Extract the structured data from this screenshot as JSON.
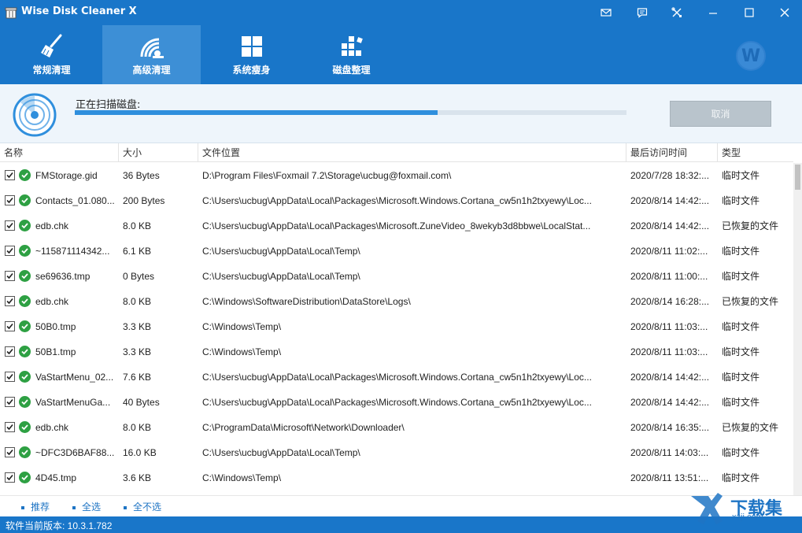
{
  "app": {
    "title": "Wise Disk Cleaner X"
  },
  "nav": {
    "tabs": [
      {
        "label": "常规清理",
        "icon": "broom-icon"
      },
      {
        "label": "高级清理",
        "icon": "satellite-dish-icon"
      },
      {
        "label": "系统瘦身",
        "icon": "windows-logo-icon"
      },
      {
        "label": "磁盘整理",
        "icon": "defrag-blocks-icon"
      }
    ],
    "active_index": 1,
    "avatar_letter": "W"
  },
  "scan": {
    "status_label": "正在扫描磁盘:",
    "progress": 0.658,
    "cancel_label": "取消"
  },
  "table": {
    "headers": [
      "名称",
      "大小",
      "文件位置",
      "最后访问时间",
      "类型"
    ],
    "rows": [
      {
        "name": "FMStorage.gid",
        "size": "36 Bytes",
        "path": "D:\\Program Files\\Foxmail 7.2\\Storage\\ucbug@foxmail.com\\",
        "time": "2020/7/28 18:32:...",
        "type": "临时文件"
      },
      {
        "name": "Contacts_01.080...",
        "size": "200 Bytes",
        "path": "C:\\Users\\ucbug\\AppData\\Local\\Packages\\Microsoft.Windows.Cortana_cw5n1h2txyewy\\Loc...",
        "time": "2020/8/14 14:42:...",
        "type": "临时文件"
      },
      {
        "name": "edb.chk",
        "size": "8.0 KB",
        "path": "C:\\Users\\ucbug\\AppData\\Local\\Packages\\Microsoft.ZuneVideo_8wekyb3d8bbwe\\LocalStat...",
        "time": "2020/8/14 14:42:...",
        "type": "已恢复的文件"
      },
      {
        "name": "~115871114342...",
        "size": "6.1 KB",
        "path": "C:\\Users\\ucbug\\AppData\\Local\\Temp\\",
        "time": "2020/8/11 11:02:...",
        "type": "临时文件"
      },
      {
        "name": "se69636.tmp",
        "size": "0 Bytes",
        "path": "C:\\Users\\ucbug\\AppData\\Local\\Temp\\",
        "time": "2020/8/11 11:00:...",
        "type": "临时文件"
      },
      {
        "name": "edb.chk",
        "size": "8.0 KB",
        "path": "C:\\Windows\\SoftwareDistribution\\DataStore\\Logs\\",
        "time": "2020/8/14 16:28:...",
        "type": "已恢复的文件"
      },
      {
        "name": "50B0.tmp",
        "size": "3.3 KB",
        "path": "C:\\Windows\\Temp\\",
        "time": "2020/8/11 11:03:...",
        "type": "临时文件"
      },
      {
        "name": "50B1.tmp",
        "size": "3.3 KB",
        "path": "C:\\Windows\\Temp\\",
        "time": "2020/8/11 11:03:...",
        "type": "临时文件"
      },
      {
        "name": "VaStartMenu_02...",
        "size": "7.6 KB",
        "path": "C:\\Users\\ucbug\\AppData\\Local\\Packages\\Microsoft.Windows.Cortana_cw5n1h2txyewy\\Loc...",
        "time": "2020/8/14 14:42:...",
        "type": "临时文件"
      },
      {
        "name": "VaStartMenuGa...",
        "size": "40 Bytes",
        "path": "C:\\Users\\ucbug\\AppData\\Local\\Packages\\Microsoft.Windows.Cortana_cw5n1h2txyewy\\Loc...",
        "time": "2020/8/14 14:42:...",
        "type": "临时文件"
      },
      {
        "name": "edb.chk",
        "size": "8.0 KB",
        "path": "C:\\ProgramData\\Microsoft\\Network\\Downloader\\",
        "time": "2020/8/14 16:35:...",
        "type": "已恢复的文件"
      },
      {
        "name": "~DFC3D6BAF88...",
        "size": "16.0 KB",
        "path": "C:\\Users\\ucbug\\AppData\\Local\\Temp\\",
        "time": "2020/8/11 14:03:...",
        "type": "临时文件"
      },
      {
        "name": "4D45.tmp",
        "size": "3.6 KB",
        "path": "C:\\Windows\\Temp\\",
        "time": "2020/8/11 13:51:...",
        "type": "临时文件"
      }
    ]
  },
  "footer": {
    "links": [
      "推荐",
      "全选",
      "全不选"
    ]
  },
  "status": {
    "version_text": "软件当前版本: 10.3.1.782"
  },
  "watermark": {
    "text": "下载集",
    "sub": "xzji.com"
  },
  "colors": {
    "brand": "#1976c9",
    "active_tab": "#3d8fd6",
    "progress": "#2f8fdd",
    "ok_green": "#2ea043"
  }
}
